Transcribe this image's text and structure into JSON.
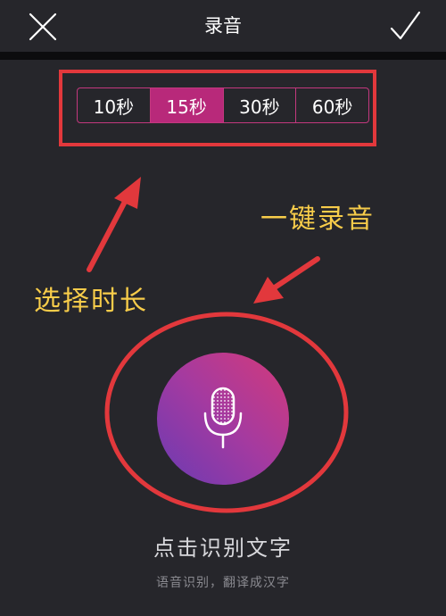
{
  "header": {
    "title": "录音",
    "close_icon": "close-icon",
    "confirm_icon": "checkmark-icon"
  },
  "duration_selector": {
    "options": [
      "10秒",
      "15秒",
      "30秒",
      "60秒"
    ],
    "selected": "15秒"
  },
  "annotations": {
    "one_click_record": "一键录音",
    "choose_duration": "选择时长"
  },
  "record": {
    "icon": "microphone-icon",
    "label": "点击识别文字",
    "sublabel": "语音识别，翻译成汉字"
  },
  "colors": {
    "background": "#26262b",
    "accent": "#b8297a",
    "annotation_red": "#e2383c",
    "annotation_yellow": "#f7cc4a"
  }
}
